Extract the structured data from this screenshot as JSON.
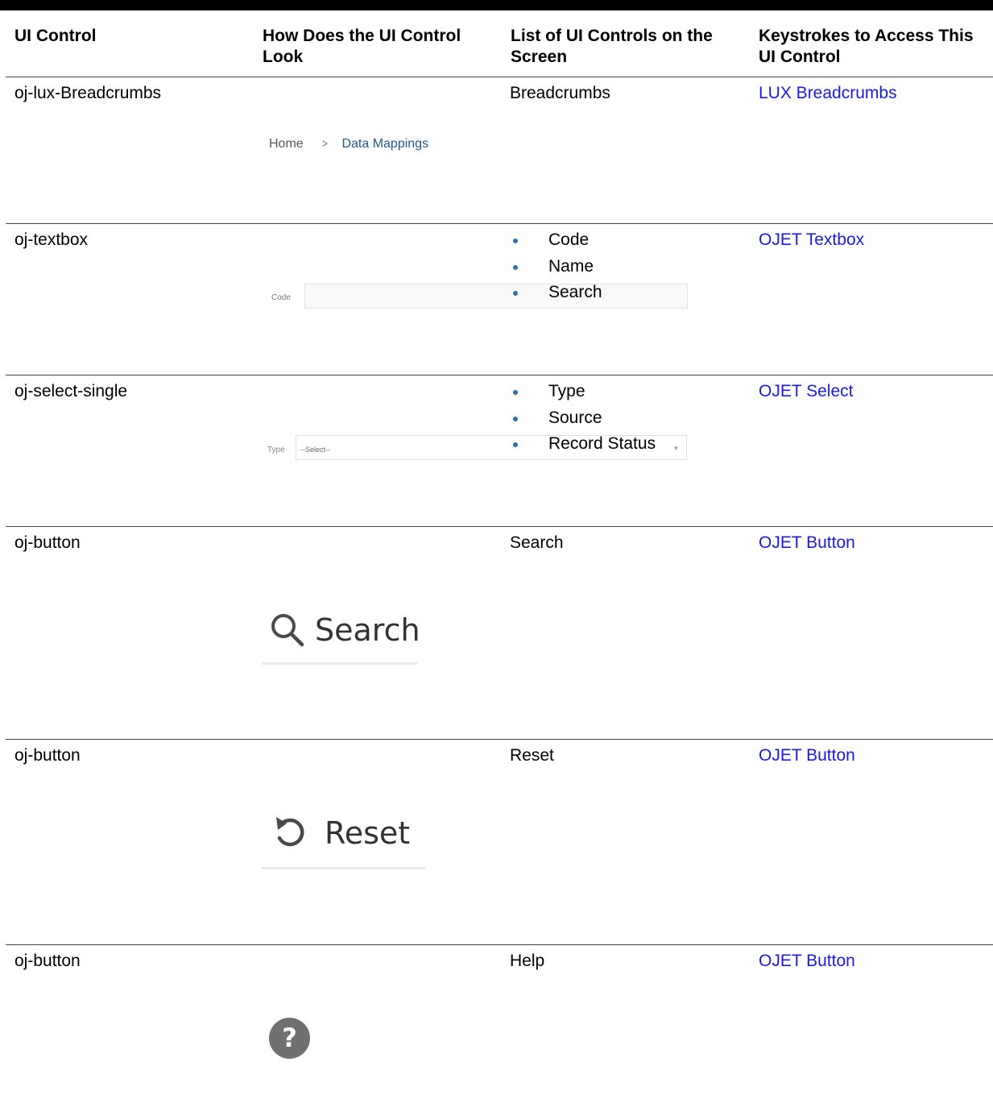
{
  "table": {
    "headers": [
      "UI Control",
      "How Does the UI Control Look",
      "List of UI Controls on the Screen",
      "Keystrokes to Access This UI Control"
    ],
    "rows": [
      {
        "control": "oj-lux-Breadcrumbs",
        "list_text": "Breadcrumbs",
        "keystrokes": "LUX Breadcrumbs",
        "sample": {
          "items": [
            "Home",
            "Data Mappings"
          ],
          "separator": ">"
        }
      },
      {
        "control": "oj-textbox",
        "list_items": [
          "Code",
          "Name",
          "Search"
        ],
        "keystrokes": "OJET Textbox",
        "sample": {
          "label": "Code"
        }
      },
      {
        "control": "oj-select-single",
        "list_items": [
          "Type",
          "Source",
          "Record Status"
        ],
        "keystrokes": "OJET Select",
        "sample": {
          "label": "Type",
          "placeholder": "--Select--",
          "caret": "▾"
        }
      },
      {
        "control": "oj-button",
        "list_text": "Search",
        "keystrokes": "OJET Button",
        "sample": {
          "label": "Search",
          "icon": "search-icon"
        }
      },
      {
        "control": "oj-button",
        "list_text": "Reset",
        "keystrokes": "OJET Button",
        "sample": {
          "label": "Reset",
          "icon": "reset-icon"
        }
      },
      {
        "control": "oj-button",
        "list_text": "Help",
        "keystrokes": "OJET Button",
        "sample": {
          "icon": "help-icon",
          "glyph": "?"
        }
      }
    ]
  },
  "colors": {
    "link": "#1a1ae6",
    "bullet": "#2e6fb6",
    "breadcrumb_current": "#1f5a8c"
  }
}
